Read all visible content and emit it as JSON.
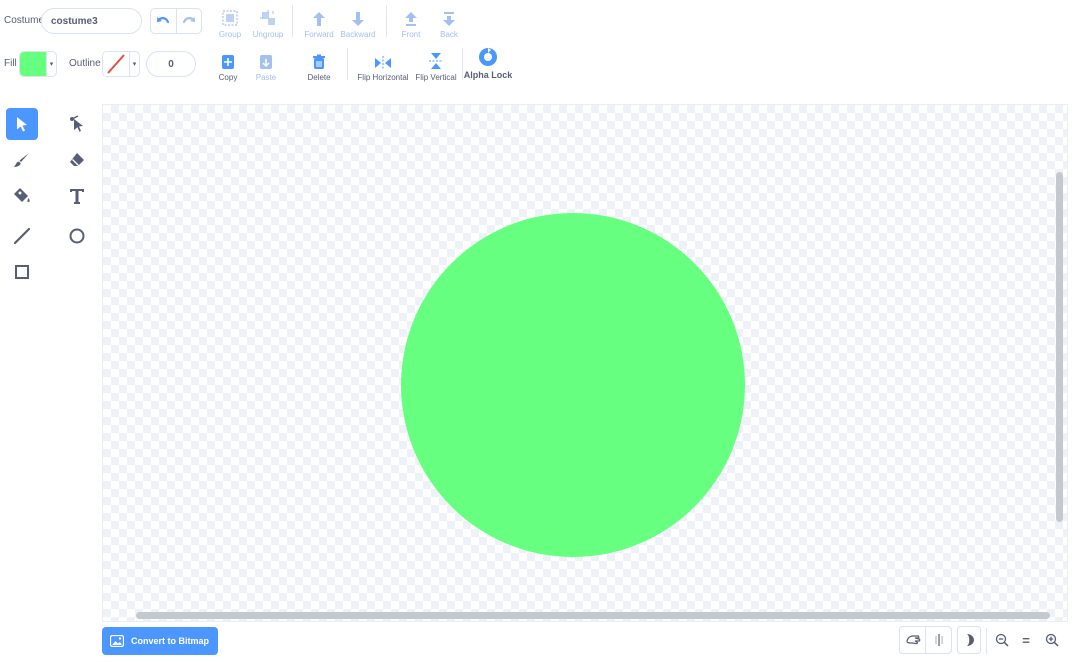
{
  "costume": {
    "label": "Costume",
    "name": "costume3"
  },
  "toolbar": {
    "undo_icon": "undo-icon",
    "redo_icon": "redo-icon",
    "group": "Group",
    "ungroup": "Ungroup",
    "forward": "Forward",
    "backward": "Backward",
    "front": "Front",
    "back": "Back",
    "copy": "Copy",
    "paste": "Paste",
    "delete": "Delete",
    "flip_horizontal": "Flip Horizontal",
    "flip_vertical": "Flip Vertical",
    "alpha_lock": "Alpha Lock"
  },
  "style": {
    "fill_label": "Fill",
    "fill_color": "#66ff80",
    "outline_label": "Outline",
    "outline_color": "none",
    "outline_width": "0"
  },
  "tools": [
    {
      "name": "select",
      "icon": "arrow-cursor-icon",
      "active": true
    },
    {
      "name": "reshape",
      "icon": "reshape-icon",
      "active": false
    },
    {
      "name": "brush",
      "icon": "brush-icon",
      "active": false
    },
    {
      "name": "eraser",
      "icon": "eraser-icon",
      "active": false
    },
    {
      "name": "fill",
      "icon": "paint-bucket-icon",
      "active": false
    },
    {
      "name": "text",
      "icon": "text-icon",
      "active": false
    },
    {
      "name": "line",
      "icon": "line-icon",
      "active": false
    },
    {
      "name": "circle",
      "icon": "circle-icon",
      "active": false
    },
    {
      "name": "rectangle",
      "icon": "rectangle-icon",
      "active": false
    }
  ],
  "canvas": {
    "shape": "circle",
    "shape_color": "#66ff80"
  },
  "bottom": {
    "convert_label": "Convert to Bitmap",
    "zoom_reset_label": "="
  },
  "colors": {
    "accent": "#4c97ff",
    "accent_light": "#a3c0ee",
    "text": "#575e75",
    "border": "#d9e3f2"
  }
}
